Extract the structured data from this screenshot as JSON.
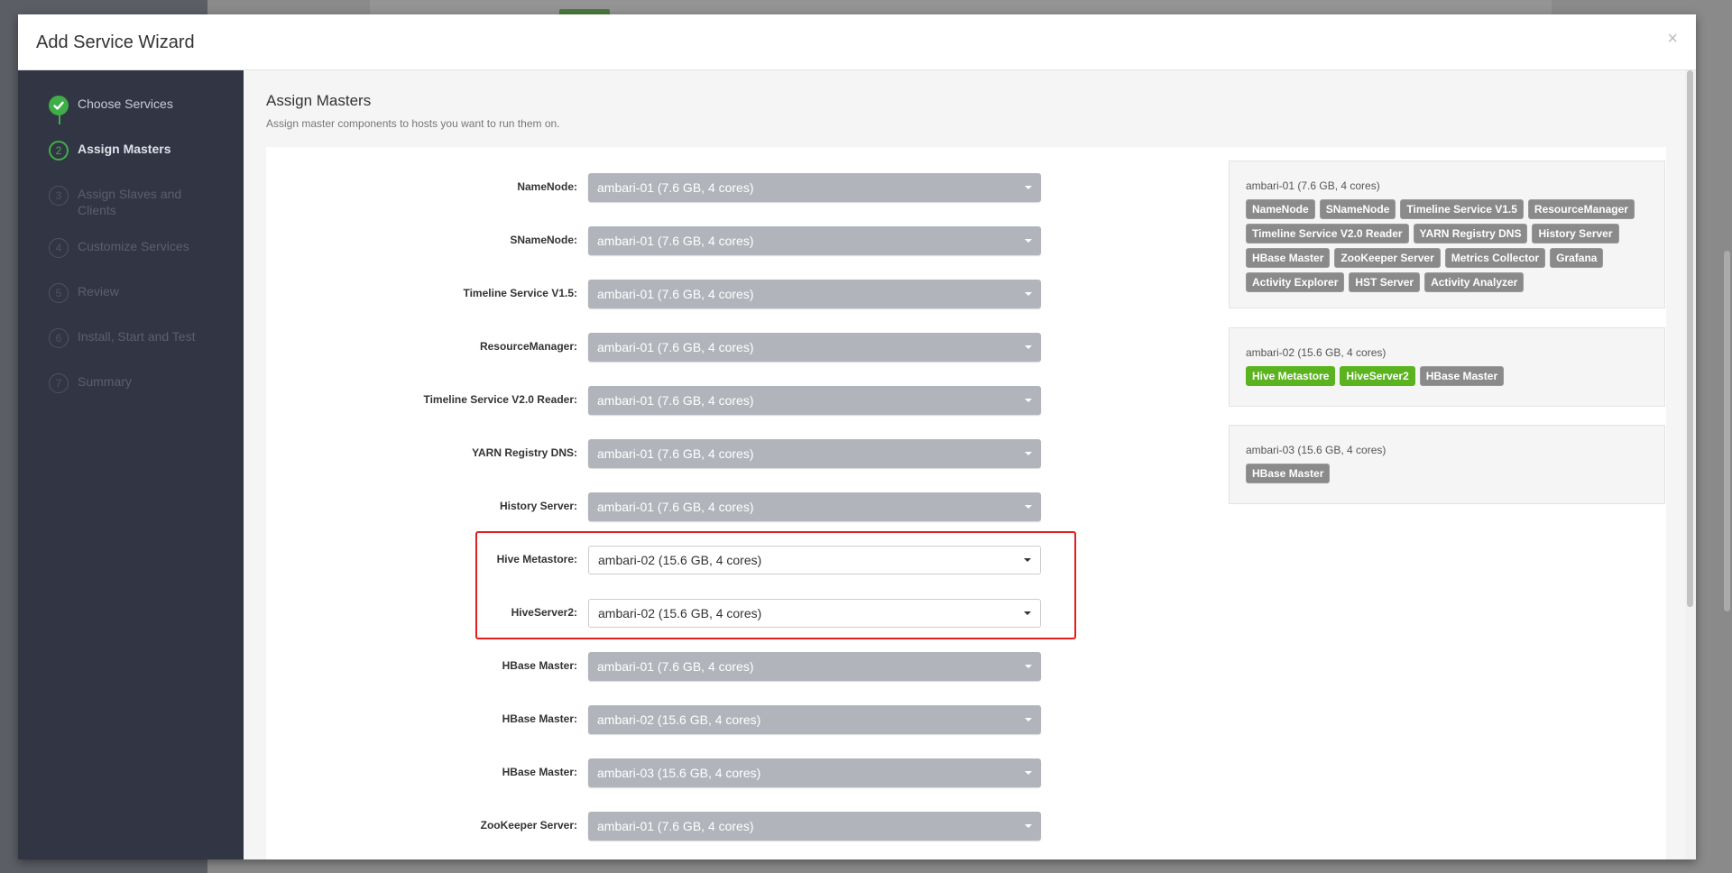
{
  "modal": {
    "title": "Add Service Wizard",
    "close": "×"
  },
  "steps": [
    {
      "number": "",
      "label": "Choose Services",
      "state": "done"
    },
    {
      "number": "2",
      "label": "Assign Masters",
      "state": "active"
    },
    {
      "number": "3",
      "label": "Assign Slaves and Clients",
      "state": "pending"
    },
    {
      "number": "4",
      "label": "Customize Services",
      "state": "pending"
    },
    {
      "number": "5",
      "label": "Review",
      "state": "pending"
    },
    {
      "number": "6",
      "label": "Install, Start and Test",
      "state": "pending"
    },
    {
      "number": "7",
      "label": "Summary",
      "state": "pending"
    }
  ],
  "content": {
    "title": "Assign Masters",
    "subtitle": "Assign master components to hosts you want to run them on."
  },
  "assignments": [
    {
      "label": "NameNode:",
      "value": "ambari-01 (7.6 GB, 4 cores)"
    },
    {
      "label": "SNameNode:",
      "value": "ambari-01 (7.6 GB, 4 cores)"
    },
    {
      "label": "Timeline Service V1.5:",
      "value": "ambari-01 (7.6 GB, 4 cores)"
    },
    {
      "label": "ResourceManager:",
      "value": "ambari-01 (7.6 GB, 4 cores)"
    },
    {
      "label": "Timeline Service V2.0 Reader:",
      "value": "ambari-01 (7.6 GB, 4 cores)"
    },
    {
      "label": "YARN Registry DNS:",
      "value": "ambari-01 (7.6 GB, 4 cores)"
    },
    {
      "label": "History Server:",
      "value": "ambari-01 (7.6 GB, 4 cores)"
    },
    {
      "label": "Hive Metastore:",
      "value": "ambari-02 (15.6 GB, 4 cores)"
    },
    {
      "label": "HiveServer2:",
      "value": "ambari-02 (15.6 GB, 4 cores)"
    },
    {
      "label": "HBase Master:",
      "value": "ambari-01 (7.6 GB, 4 cores)"
    },
    {
      "label": "HBase Master:",
      "value": "ambari-02 (15.6 GB, 4 cores)"
    },
    {
      "label": "HBase Master:",
      "value": "ambari-03 (15.6 GB, 4 cores)"
    },
    {
      "label": "ZooKeeper Server:",
      "value": "ambari-01 (7.6 GB, 4 cores)"
    }
  ],
  "hosts": [
    {
      "name": "ambari-01 (7.6 GB, 4 cores)",
      "components": [
        "NameNode",
        "SNameNode",
        "Timeline Service V1.5",
        "ResourceManager",
        "Timeline Service V2.0 Reader",
        "YARN Registry DNS",
        "History Server",
        "HBase Master",
        "ZooKeeper Server",
        "Metrics Collector",
        "Grafana",
        "Activity Explorer",
        "HST Server",
        "Activity Analyzer"
      ],
      "new_components": []
    },
    {
      "name": "ambari-02 (15.6 GB, 4 cores)",
      "components": [
        "Hive Metastore",
        "HiveServer2",
        "HBase Master"
      ],
      "new_components": [
        "Hive Metastore",
        "HiveServer2"
      ]
    },
    {
      "name": "ambari-03 (15.6 GB, 4 cores)",
      "components": [
        "HBase Master"
      ],
      "new_components": []
    }
  ],
  "colors": {
    "accent_green": "#3fae49",
    "new_tag_green": "#5bb41f",
    "highlight_red": "#e11d1d",
    "sidebar": "#323544"
  }
}
